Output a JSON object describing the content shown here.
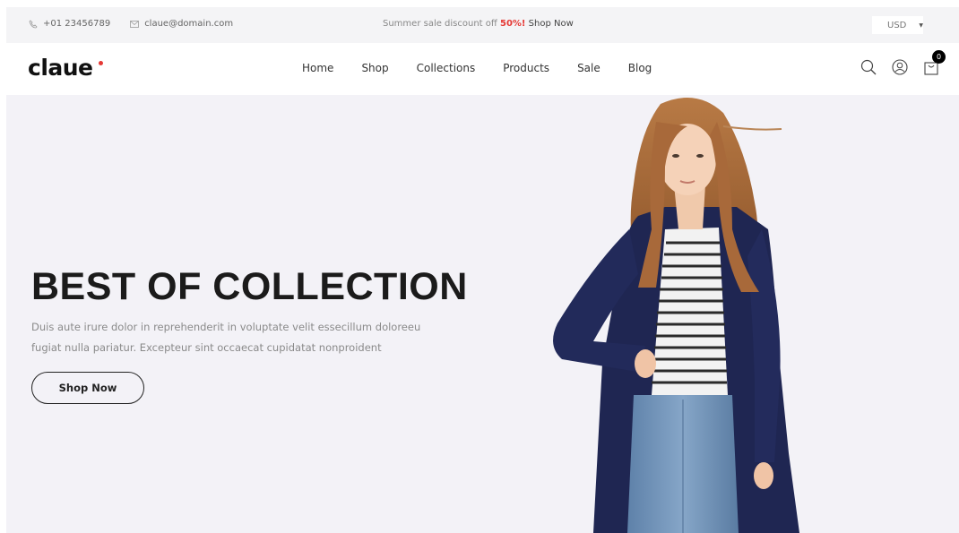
{
  "topbar": {
    "phone": "+01 23456789",
    "email": "claue@domain.com",
    "promo_prefix": "Summer sale discount off",
    "promo_highlight": "50%!",
    "promo_link": "Shop Now",
    "currency": "USD",
    "icons": [
      "phone-icon",
      "mail-icon",
      "caret-down-icon"
    ]
  },
  "header": {
    "logo": "claue",
    "nav": [
      "Home",
      "Shop",
      "Collections",
      "Products",
      "Sale",
      "Blog"
    ],
    "icons": [
      "search-icon",
      "account-icon",
      "cart-icon"
    ],
    "cart_count": "0"
  },
  "hero": {
    "title": "BEST OF COLLECTION",
    "description_line1": "Duis aute irure dolor in reprehenderit in voluptate velit essecillum doloreeu",
    "description_line2": "fugiat nulla pariatur. Excepteur sint occaecat cupidatat nonproident",
    "button": "Shop Now"
  },
  "colors": {
    "accent": "#e53935",
    "hero_bg": "#f3f2f7",
    "topbar_bg": "#f4f4f6",
    "cardigan": "#1f2652",
    "jeans": "#6c8db4"
  }
}
